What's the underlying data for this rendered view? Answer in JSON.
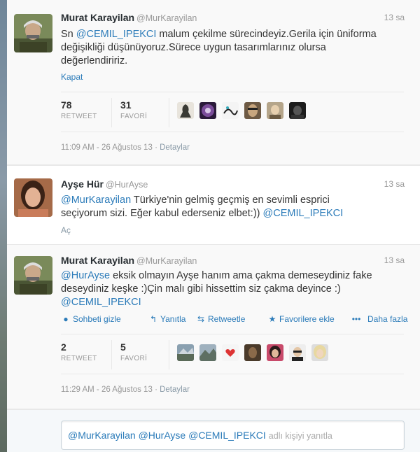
{
  "tweets": [
    {
      "name": "Murat Karayilan",
      "handle": "@MurKarayilan",
      "time": "13 sa",
      "text_mention": "@CEMIL_IPEKCI",
      "text_pre": "Sn ",
      "text_line1_rest": " malum çekilme sürecindeyiz.Gerila için üniforma",
      "text_line2": "değişikliği düşünüyoruz.Sürece uygun tasarımlarınız olursa",
      "text_line3": "değerlendiririz.",
      "toggle": "Kapat",
      "retweets": {
        "num": "78",
        "label": "RETWEET"
      },
      "favorites": {
        "num": "31",
        "label": "FAVORİ"
      },
      "favoriter_icons": [
        "avatar-statue",
        "avatar-purple",
        "avatar-drawing",
        "avatar-face",
        "avatar-portrait",
        "avatar-dark"
      ],
      "timestamp": "11:09 AM - 26 Ağustos 13",
      "details": "Detaylar"
    },
    {
      "name": "Ayşe Hür",
      "handle": "@HurAyse",
      "time": "13 sa",
      "line1_mention": "@MurKarayilan",
      "line1_rest": " Türkiye'nin gelmiş geçmiş en sevimli esprici",
      "line2_pre": "seçiyorum sizi. Eğer kabul ederseniz elbet:)) ",
      "line2_mention": "@CEMIL_IPEKCI",
      "toggle": "Aç"
    },
    {
      "name": "Murat Karayilan",
      "handle": "@MurKarayilan",
      "time": "13 sa",
      "line1_mention": "@HurAyse",
      "line1_rest": " eksik olmayın Ayşe hanım ama çakma demeseydiniz fake",
      "line2": "deseydiniz keşke :)Çin malı gibi hissettim siz çakma deyince :)",
      "line3_mention": "@CEMIL_IPEKCI",
      "actions": {
        "hide": "Sohbeti gizle",
        "reply": "Yanıtla",
        "retweet": "Retweetle",
        "favorite": "Favorilere ekle",
        "more": "Daha fazla"
      },
      "retweets": {
        "num": "2",
        "label": "RETWEET"
      },
      "favorites": {
        "num": "5",
        "label": "FAVORİ"
      },
      "favoriter_icons": [
        "avatar-landscape",
        "avatar-mountain",
        "avatar-heart",
        "avatar-brown",
        "avatar-woman",
        "avatar-glasses",
        "avatar-blonde"
      ],
      "timestamp": "11:29 AM - 26 Ağustos 13",
      "details": "Detaylar"
    }
  ],
  "reply": {
    "mentions": "@MurKarayilan @HurAyse @CEMIL_IPEKCI",
    "placeholder": "adlı kişiyi yanıtla"
  },
  "colors": {
    "link": "#2b7bb9",
    "muted": "#999999",
    "brand_bg": "#ffffff"
  }
}
